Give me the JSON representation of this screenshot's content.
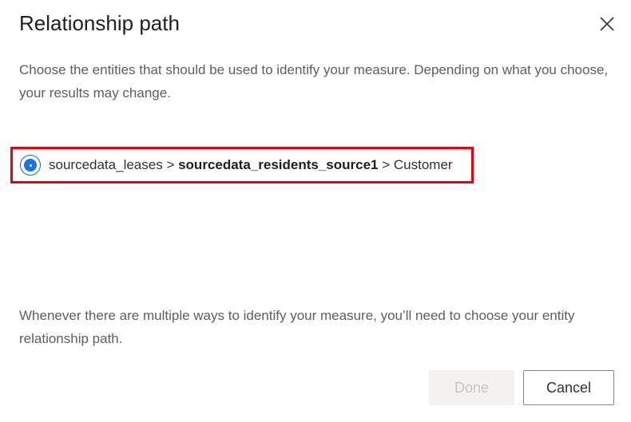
{
  "dialog": {
    "title": "Relationship path",
    "close_icon": "close-icon",
    "description": "Choose the entities that should be used to identify your measure. Depending on what you choose, your results may change.",
    "path_option": {
      "selected": true,
      "segments": [
        {
          "text": "sourcedata_leases",
          "bold": false
        },
        {
          "text": " > ",
          "bold": false
        },
        {
          "text": "sourcedata_residents_source1",
          "bold": true
        },
        {
          "text": " > ",
          "bold": false
        },
        {
          "text": "Customer",
          "bold": false
        }
      ],
      "highlight_color": "#e8000b",
      "radio_color": "#1a73e8"
    },
    "footer_note": "Whenever there are multiple ways to identify your measure, you’ll need to choose your entity relationship path.",
    "buttons": {
      "done_label": "Done",
      "done_enabled": false,
      "cancel_label": "Cancel"
    }
  }
}
